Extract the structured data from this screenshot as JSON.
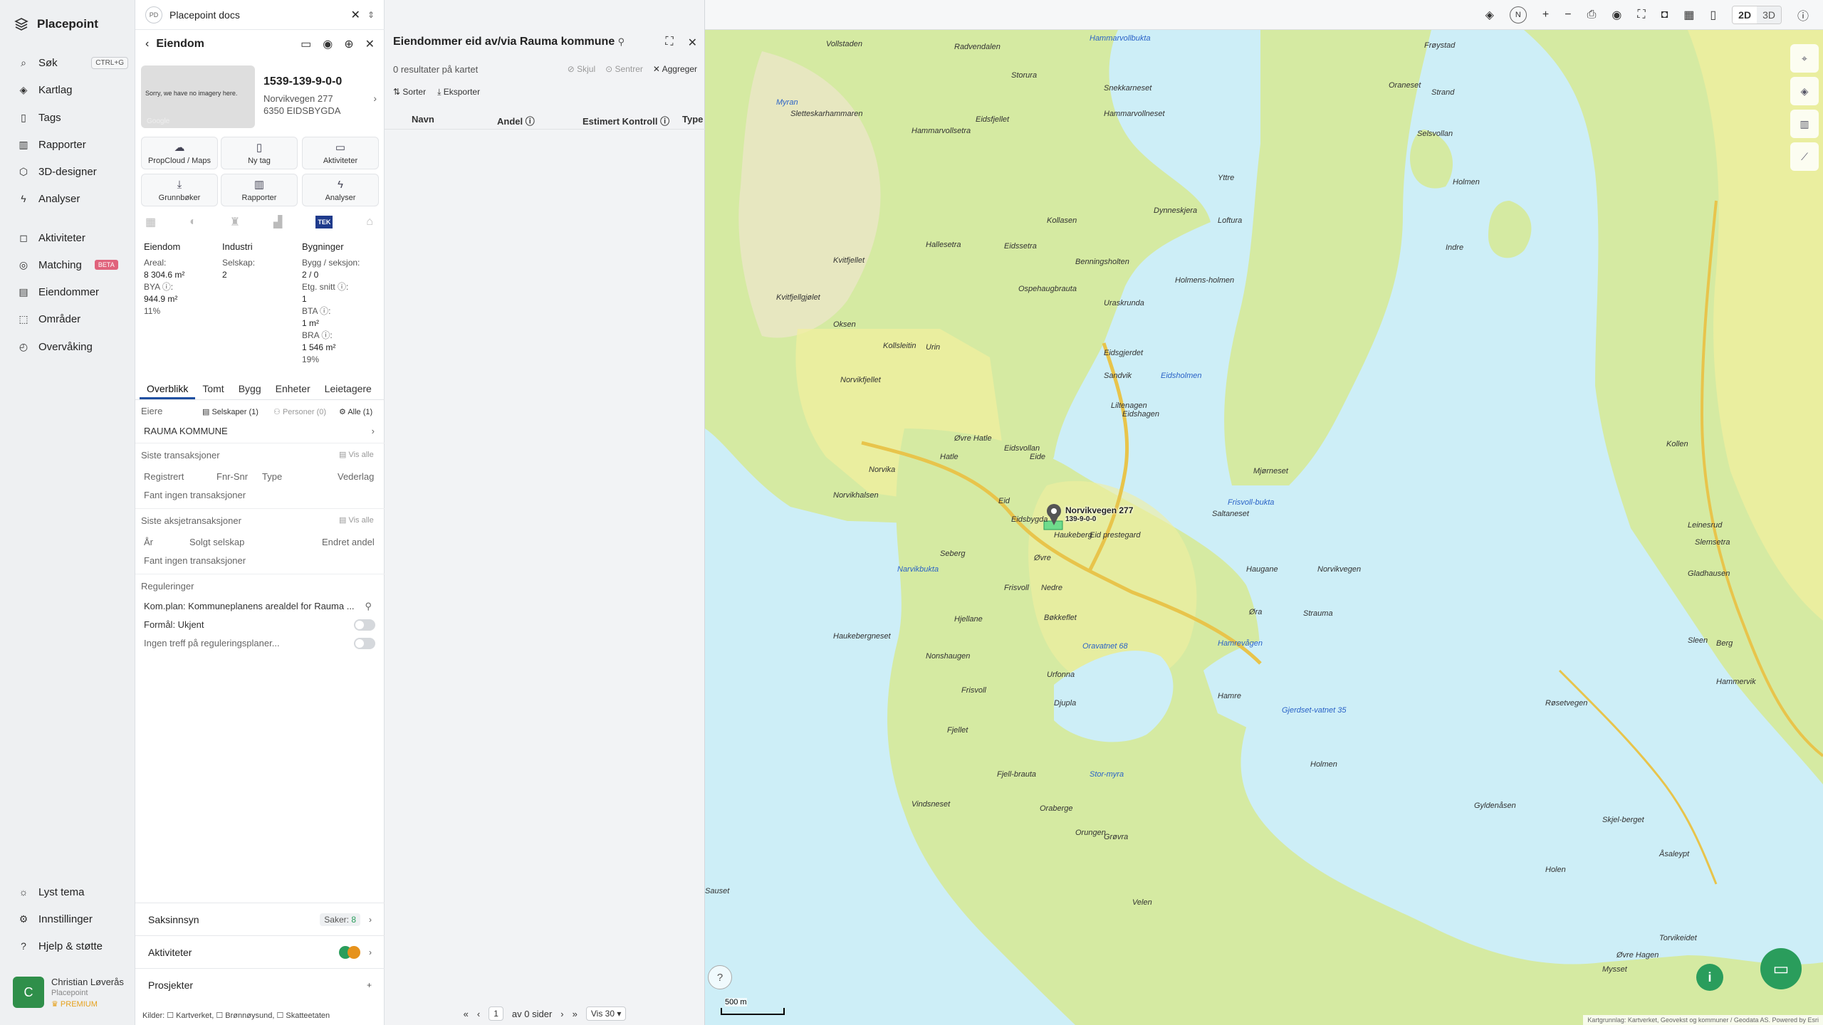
{
  "nav": {
    "brand": "Placepoint",
    "items": [
      {
        "label": "Søk",
        "icon": "search-icon",
        "kbd": "CTRL+G"
      },
      {
        "label": "Kartlag",
        "icon": "layers-icon"
      },
      {
        "label": "Tags",
        "icon": "bookmark-icon"
      },
      {
        "label": "Rapporter",
        "icon": "chart-icon"
      },
      {
        "label": "3D-designer",
        "icon": "cube-icon"
      },
      {
        "label": "Analyser",
        "icon": "bolt-icon"
      },
      {
        "label": "Aktiviteter",
        "icon": "chat-icon"
      },
      {
        "label": "Matching",
        "icon": "target-icon",
        "badge": "BETA"
      },
      {
        "label": "Eiendommer",
        "icon": "building-icon"
      },
      {
        "label": "Områder",
        "icon": "area-icon"
      },
      {
        "label": "Overvåking",
        "icon": "monitor-icon"
      }
    ],
    "bottom": [
      {
        "label": "Lyst tema",
        "icon": "sun-icon"
      },
      {
        "label": "Innstillinger",
        "icon": "gear-icon"
      },
      {
        "label": "Hjelp & støtte",
        "icon": "help-icon"
      }
    ],
    "user": {
      "initial": "C",
      "name": "Christian Løverås",
      "org": "Placepoint",
      "plan": "PREMIUM"
    }
  },
  "doc": {
    "badge": "PD",
    "title": "Placepoint docs"
  },
  "property": {
    "header": "Eiendom",
    "thumb_text": "Sorry, we have no imagery here.",
    "thumb_google": "Google",
    "id": "1539-139-9-0-0",
    "address1": "Norvikvegen 277",
    "address2": "6350 EIDSBYGDA",
    "actions": [
      {
        "label": "PropCloud / Maps"
      },
      {
        "label": "Ny tag"
      },
      {
        "label": "Aktiviteter"
      },
      {
        "label": "Grunnbøker"
      },
      {
        "label": "Rapporter"
      },
      {
        "label": "Analyser"
      }
    ],
    "tek": "TEK",
    "eiendom": {
      "h": "Eiendom",
      "areal_label": "Areal:",
      "areal": "8 304.6 m²",
      "bya_label": "BYA ⓘ:",
      "bya": "944.9 m²",
      "bya_pct": "11%"
    },
    "industri": {
      "h": "Industri",
      "selskap_label": "Selskap:",
      "selskap": "2"
    },
    "bygninger": {
      "h": "Bygninger",
      "bygg_label": "Bygg / seksjon:",
      "bygg": "2 / 0",
      "etg_label": "Etg. snitt ⓘ:",
      "etg": "1",
      "bta_label": "BTA ⓘ:",
      "bta": "1 m²",
      "bra_label": "BRA ⓘ:",
      "bra": "1 546 m²",
      "bra_pct": "19%"
    },
    "tabs": [
      "Overblikk",
      "Tomt",
      "Bygg",
      "Enheter",
      "Leietagere"
    ],
    "eiere": {
      "h": "Eiere",
      "selskaper": "Selskaper (1)",
      "personer": "Personer (0)",
      "alle": "Alle (1)",
      "owner": "RAUMA KOMMUNE"
    },
    "trans": {
      "h": "Siste transaksjoner",
      "vis": "Vis alle",
      "cols": [
        "Registrert",
        "Fnr-Snr",
        "Type",
        "Vederlag"
      ],
      "empty": "Fant ingen transaksjoner"
    },
    "aksje": {
      "h": "Siste aksjetransaksjoner",
      "vis": "Vis alle",
      "cols": [
        "År",
        "Solgt selskap",
        "Endret andel"
      ],
      "empty": "Fant ingen transaksjoner"
    },
    "reg": {
      "h": "Reguleringer",
      "plan": "Kom.plan: Kommuneplanens arealdel for Rauma ...",
      "formal": "Formål: Ukjent",
      "ingen": "Ingen treff på reguleringsplaner..."
    },
    "saks": {
      "label": "Saksinnsyn",
      "saker_label": "Saker:",
      "saker": "8"
    },
    "aktiviteter": "Aktiviteter",
    "prosjekter": "Prosjekter",
    "kilder": "Kilder: ☐ Kartverket, ☐ Brønnøysund, ☐ Skatteetaten"
  },
  "owners": {
    "title": "Eiendommer eid av/via Rauma kommune",
    "results": "0 resultater på kartet",
    "skjul": "Skjul",
    "sentrer": "Sentrer",
    "aggreger": "Aggreger",
    "sorter": "Sorter",
    "eksporter": "Eksporter",
    "cols": [
      "Navn",
      "Andel ⓘ",
      "Estimert Kontroll ⓘ",
      "Type"
    ],
    "pager": {
      "page": "1",
      "of": "av 0 sider",
      "vis": "Vis 30"
    }
  },
  "map": {
    "view_2d": "2D",
    "view_3d": "3D",
    "compass": "N",
    "scale": "500 m",
    "attribution": "Kartgrunnlag: Kartverket, Geovekst og kommuner / Geodata AS. Powered by Esri",
    "pin_label": "Norvikvegen 277",
    "pin_sub": "139-9-0-0",
    "labels": [
      {
        "t": "Vollstaden"
      },
      {
        "t": "Radvendalen"
      },
      {
        "t": "Hammarvollbukta",
        "w": true
      },
      {
        "t": "Storura"
      },
      {
        "t": "Snekkarneset"
      },
      {
        "t": "Oraneset"
      },
      {
        "t": "Frøystad"
      },
      {
        "t": "Sletteskarhammaren"
      },
      {
        "t": "Eidsfjellet"
      },
      {
        "t": "Myran",
        "w": true
      },
      {
        "t": "Hammarvollsetra"
      },
      {
        "t": "Hammarvollneset"
      },
      {
        "t": "Selsvollan"
      },
      {
        "t": "Strand"
      },
      {
        "t": "Yttre"
      },
      {
        "t": "Holmen"
      },
      {
        "t": "Dynneskjera"
      },
      {
        "t": "Loftura"
      },
      {
        "t": "Kvitfjellet"
      },
      {
        "t": "Hallesetra"
      },
      {
        "t": "Eidssetra"
      },
      {
        "t": "Kollasen"
      },
      {
        "t": "Benningsholten"
      },
      {
        "t": "Ospehaugbrauta"
      },
      {
        "t": "Holmens-holmen"
      },
      {
        "t": "Indre"
      },
      {
        "t": "Kvitfjellgjølet"
      },
      {
        "t": "Oksen"
      },
      {
        "t": "Kollsleitin"
      },
      {
        "t": "Urin"
      },
      {
        "t": "Uraskrunda"
      },
      {
        "t": "Eidsgjerdet"
      },
      {
        "t": "Sandvik"
      },
      {
        "t": "Eidsholmen",
        "w": true
      },
      {
        "t": "Norvikfjellet"
      },
      {
        "t": "Liltenagen"
      },
      {
        "t": "Eidshagen"
      },
      {
        "t": "Øvre Hatle"
      },
      {
        "t": "Eidsvollan"
      },
      {
        "t": "Norvika"
      },
      {
        "t": "Hatle"
      },
      {
        "t": "Eide"
      },
      {
        "t": "Mjørneset"
      },
      {
        "t": "Norvikhalsen"
      },
      {
        "t": "Frisvoll-bukta",
        "w": true
      },
      {
        "t": "Saltaneset"
      },
      {
        "t": "Eid"
      },
      {
        "t": "Eidsbygda"
      },
      {
        "t": "Eid prestegard"
      },
      {
        "t": "Haukeberg"
      },
      {
        "t": "Seberg"
      },
      {
        "t": "Øvre"
      },
      {
        "t": "Norvikvegen"
      },
      {
        "t": "Haugane"
      },
      {
        "t": "Narvikbukta",
        "w": true
      },
      {
        "t": "Frisvoll"
      },
      {
        "t": "Nedre"
      },
      {
        "t": "Bøkkeflet"
      },
      {
        "t": "Øra"
      },
      {
        "t": "Strauma"
      },
      {
        "t": "Hjellane"
      },
      {
        "t": "Haukebergneset"
      },
      {
        "t": "Oravatnet 68",
        "w": true
      },
      {
        "t": "Hamrevågen",
        "w": true
      },
      {
        "t": "Nonshaugen"
      },
      {
        "t": "Urfonna"
      },
      {
        "t": "Frisvoll"
      },
      {
        "t": "Djupla"
      },
      {
        "t": "Hamre"
      },
      {
        "t": "Gjerdset-vatnet 35",
        "w": true
      },
      {
        "t": "Fjellet"
      },
      {
        "t": "Fjell-brauta"
      },
      {
        "t": "Stor-myra",
        "w": true
      },
      {
        "t": "Holmen"
      },
      {
        "t": "Vindsneset"
      },
      {
        "t": "Oraberge"
      },
      {
        "t": "Orungen"
      },
      {
        "t": "Grøvra"
      },
      {
        "t": "Gyldenåsen"
      },
      {
        "t": "Skjel-berget"
      },
      {
        "t": "Åsaleypt"
      },
      {
        "t": "Sauset"
      },
      {
        "t": "Velen"
      },
      {
        "t": "Holen"
      },
      {
        "t": "Øvre Hagen"
      },
      {
        "t": "Mysset"
      },
      {
        "t": "Torvikeidet"
      },
      {
        "t": "Kollen"
      },
      {
        "t": "Leinesrud"
      },
      {
        "t": "Slemsetra"
      },
      {
        "t": "Gladhausen"
      },
      {
        "t": "Berg"
      },
      {
        "t": "Sleen"
      },
      {
        "t": "Hammervik"
      },
      {
        "t": "Røsetvegen"
      }
    ]
  }
}
